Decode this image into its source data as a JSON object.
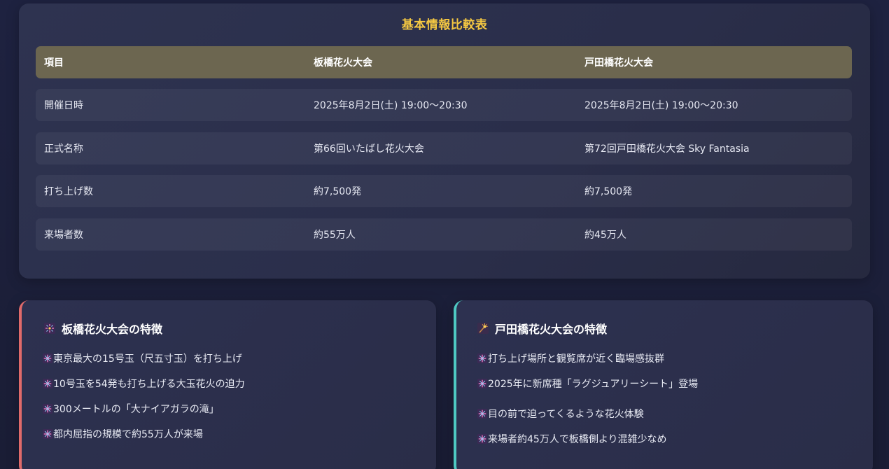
{
  "comparison": {
    "title": "基本情報比較表",
    "header": {
      "col1": "項目",
      "col2": "板橋花火大会",
      "col3": "戸田橋花火大会"
    },
    "rows": [
      {
        "label": "開催日時",
        "itabashi": "2025年8月2日(土) 19:00〜20:30",
        "toda": "2025年8月2日(土) 19:00〜20:30"
      },
      {
        "label": "正式名称",
        "itabashi": "第66回いたばし花火大会",
        "toda": "第72回戸田橋花火大会 Sky Fantasia"
      },
      {
        "label": "打ち上げ数",
        "itabashi": "約7,500発",
        "toda": "約7,500発"
      },
      {
        "label": "来場者数",
        "itabashi": "約55万人",
        "toda": "約45万人"
      }
    ]
  },
  "features": {
    "itabashi": {
      "title": "板橋花火大会の特徴",
      "icon": "fireworks-icon",
      "accent": "#e06a6a",
      "items": [
        "東京最大の15号玉（尺五寸玉）を打ち上げ",
        "10号玉を54発も打ち上げる大玉花火の迫力",
        "300メートルの「大ナイアガラの滝」",
        "都内屈指の規模で約55万人が来場"
      ]
    },
    "toda": {
      "title": "戸田橋花火大会の特徴",
      "icon": "sparkler-icon",
      "accent": "#4ec9c2",
      "items": [
        "打ち上げ場所と観覧席が近く臨場感抜群",
        "2025年に新席種「ラグジュアリーシート」登場",
        "目の前で迫ってくるような花火体験",
        "来場者約45万人で板橋側より混雑少なめ"
      ]
    }
  }
}
